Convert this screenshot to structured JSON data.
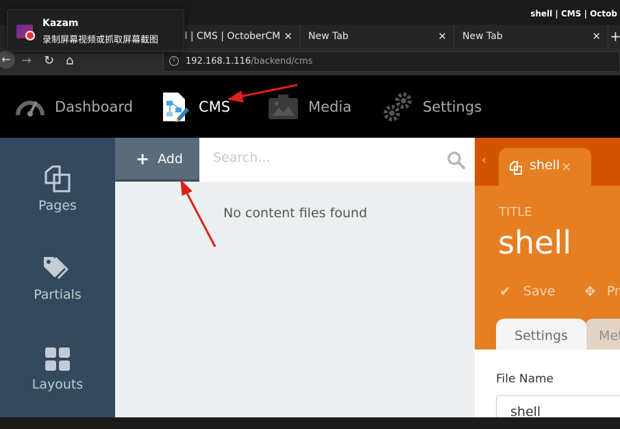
{
  "window_title": "shell | CMS | Octob",
  "browser": {
    "tabs": [
      {
        "label": "shell | CMS | OctoberCMS",
        "visible_label": "ell | CMS | OctoberCM"
      },
      {
        "label": "New Tab"
      },
      {
        "label": "New Tab"
      }
    ],
    "new_tab_label": "+",
    "url_host": "192.168.1.116",
    "url_path": "/backend/cms"
  },
  "notification": {
    "title": "Kazam",
    "description": "录制屏幕视频或抓取屏幕截图"
  },
  "top_menu": [
    {
      "label": "Dashboard",
      "icon": "speedometer-icon",
      "active": false
    },
    {
      "label": "CMS",
      "icon": "cms-document-icon",
      "active": true
    },
    {
      "label": "Media",
      "icon": "media-camera-icon",
      "active": false
    },
    {
      "label": "Settings",
      "icon": "gears-icon",
      "active": false
    }
  ],
  "sidebar": {
    "items": [
      {
        "label": "Pages",
        "icon": "pages-icon"
      },
      {
        "label": "Partials",
        "icon": "tags-icon"
      },
      {
        "label": "Layouts",
        "icon": "grid-icon"
      }
    ]
  },
  "list_panel": {
    "add_label": "Add",
    "search_placeholder": "Search...",
    "empty_message": "No content files found"
  },
  "editor": {
    "open_tab_label": "shell",
    "title_label": "TITLE",
    "title_value": "shell",
    "save_label": "Save",
    "preview_label": "Pr",
    "tabs": [
      "Settings",
      "Met"
    ],
    "file_name_label": "File Name",
    "file_name_value": "shell"
  },
  "colors": {
    "sidebar": "#34495e",
    "editor_accent": "#e67e22",
    "editor_header": "#d35400",
    "annotation_arrow": "#e0201a"
  }
}
